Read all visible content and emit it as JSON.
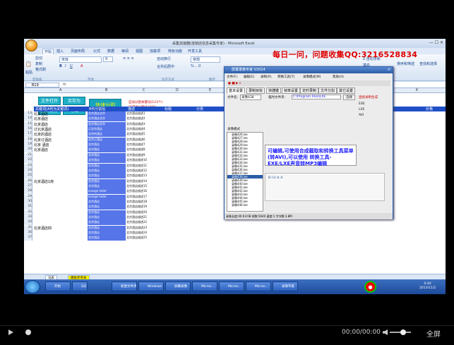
{
  "window": {
    "title": "采集加速器(连锁店信息采集专家) - Microsoft Excel"
  },
  "ribbon_tabs": [
    "开始",
    "插入",
    "页面布局",
    "公式",
    "数据",
    "审阅",
    "视图",
    "加载项",
    "特色功能",
    "开发工具"
  ],
  "ribbon": {
    "paste": "粘贴",
    "cut": "剪切",
    "copy": "复制",
    "format_painter": "格式刷",
    "font": "宋体",
    "font_size": "9",
    "wrap": "自动换行",
    "merge": "合并后居中",
    "number_format": "常规",
    "sum": "Σ 自动求和",
    "fill": "填充",
    "clear": "清除",
    "sort": "排序和筛选",
    "find": "查找和选择",
    "groups": [
      "剪贴板",
      "字体",
      "对齐方式",
      "数字"
    ]
  },
  "banner": {
    "text": "每日一问，问题收集QQ:",
    "qq": "3216528834"
  },
  "formula_bar": {
    "cell": "B19",
    "fx": "fx"
  },
  "columns": [
    "A",
    "B",
    "C",
    "D",
    "E",
    "F",
    "G",
    "H",
    "I",
    "J",
    "K"
  ],
  "buttons": {
    "open": "文件打开",
    "save_as": "另存为",
    "open_file": "打开文件",
    "export": "导出",
    "quick_split": "快速分割"
  },
  "sheet": {
    "header": [
      "关键词(A列为关键词)",
      "B列分割后",
      "描述",
      "标题",
      "分类",
      "地址",
      "备注",
      "价格"
    ],
    "notes": [
      "自动分割关键词(123个)",
      "已成功分割(124个)"
    ],
    "rows": [
      {
        "n": "13",
        "a": "北京酒店",
        "b": "北京酒店北京",
        "c": "北京酒店描述1"
      },
      {
        "n": "14",
        "a": "北京酒店",
        "b": "北京酒店北京",
        "c": "北京酒店描述2"
      },
      {
        "n": "15",
        "a": "北京酒店",
        "b": "北京酒店北京",
        "c": "北京酒店描述3"
      },
      {
        "n": "16",
        "a": "订北京酒店",
        "b": "订北京酒店",
        "c": "北京酒店描述4"
      },
      {
        "n": "17",
        "a": "北京的酒店",
        "b": "北京的酒店",
        "c": "北京酒店描述5"
      },
      {
        "n": "18",
        "a": "北京订酒店",
        "b": "北京订酒店",
        "c": "北京酒店描述6"
      },
      {
        "n": "19",
        "a": "北京 酒店",
        "b": "北京酒店",
        "c": "北京酒店描述7"
      },
      {
        "n": "20",
        "a": "北京酒店",
        "b": "北京酒店",
        "c": "北京酒店描述8"
      },
      {
        "n": "21",
        "a": "",
        "b": "北京酒店",
        "c": "北京酒店描述9"
      },
      {
        "n": "22",
        "a": "",
        "b": "北京酒店",
        "c": "北京酒店描述10"
      },
      {
        "n": "23",
        "a": "",
        "b": "北京酒店",
        "c": "北京酒店描述11"
      },
      {
        "n": "24",
        "a": "",
        "b": "北京酒店",
        "c": "北京酒店描述12"
      },
      {
        "n": "25",
        "a": "",
        "b": "北京酒店",
        "c": "北京酒店描述13"
      },
      {
        "n": "26",
        "a": "北京酒店1房",
        "b": "北京酒店",
        "c": "北京酒店描述14"
      },
      {
        "n": "27",
        "a": "",
        "b": "北京酒店",
        "c": "北京酒店描述15"
      },
      {
        "n": "28",
        "a": "",
        "b": "orange hotel",
        "c": "北京酒店描述16"
      },
      {
        "n": "29",
        "a": "",
        "b": "orange hotel",
        "c": "北京酒店描述17"
      },
      {
        "n": "30",
        "a": "",
        "b": "北京酒店",
        "c": "北京酒店描述18"
      },
      {
        "n": "31",
        "a": "",
        "b": "北京酒店",
        "c": "北京酒店描述19"
      },
      {
        "n": "32",
        "a": "",
        "b": "北京酒店",
        "c": "北京酒店描述20"
      },
      {
        "n": "33",
        "a": "",
        "b": "北京酒店",
        "c": "北京酒店描述21"
      },
      {
        "n": "34",
        "a": "",
        "b": "北京酒店",
        "c": "北京酒店描述22"
      },
      {
        "n": "35",
        "a": "北京酒店四",
        "b": "北京酒店",
        "c": "北京酒店描述23"
      },
      {
        "n": "36",
        "a": "",
        "b": "北京酒店",
        "c": "北京酒店描述24"
      },
      {
        "n": "37",
        "a": "",
        "b": "北京酒店",
        "c": "北京酒店描述25"
      }
    ]
  },
  "sheet_tabs": [
    "词表",
    "模板参考表"
  ],
  "dialog": {
    "title": "屏幕录像专家 V2014",
    "menu": [
      "文件(F)",
      "编辑(E)",
      "录制(R)",
      "转换工具(T)",
      "录像模式(M)",
      "帮助(H)"
    ],
    "tabs": [
      "基本设置",
      "录制目标",
      "快捷键",
      "帧率设置",
      "定时录制",
      "文件分割",
      "其它设置"
    ],
    "file_label": "文件名:",
    "file_value": "录像438",
    "path_label": "临时文件夹:",
    "path_value": "C:\\Program Files\\LXE",
    "browse": "选择",
    "direct_mode": "直接录制生成",
    "exe": "EXE",
    "lxe": "LXE",
    "avi": "AVI",
    "list_title": "录像模式",
    "files": [
      "录像426.lxe",
      "录像427.lxe",
      "录像428.lxe",
      "录像429.lxe",
      "录像430.lxe",
      "录像431.lxe",
      "录像432.lxe",
      "录像433.lxe",
      "录像434.lxe",
      "录像435.lxe",
      "录像436.lxe",
      "录像437.lxe",
      "录像438.lxe",
      "录像439.lxe",
      "录像440.lxe",
      "录像441.lxe",
      "录像442.lxe",
      "录像443.lxe",
      "录像444.lxe",
      "录像445.lxe",
      "录像446.lxe"
    ],
    "tip": "可编辑,可使用合成截取和转换工具菜单(转AVI),可以使用 转换工具-EXE/LXE声音转MP3编辑",
    "status": "录像长度:00:03:08 帧数:5640 速度:1 字节数:3.8M"
  },
  "taskbar": {
    "items": [
      "开始",
      "QQ",
      "",
      ".",
      "新建文件夹",
      "Windows",
      "屏幕录像",
      "Micros...",
      "Micros...",
      "Micros...",
      "录像专家"
    ],
    "clock_time": "0:40",
    "clock_date": "2013/11/2"
  },
  "player": {
    "time": "00:00/00:00",
    "fullscreen": "全屏"
  }
}
